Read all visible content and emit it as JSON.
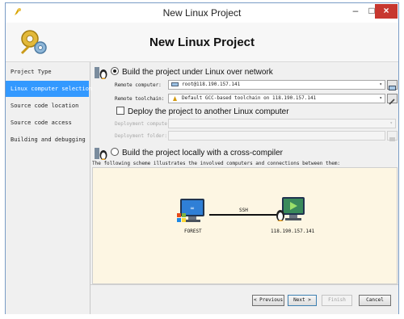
{
  "window": {
    "title": "New Linux Project",
    "minimize": "–",
    "maximize": "□",
    "close": "×"
  },
  "header": {
    "title": "New Linux Project"
  },
  "sidebar": {
    "items": [
      {
        "label": "Project Type"
      },
      {
        "label": "Linux computer selection"
      },
      {
        "label": "Source code location"
      },
      {
        "label": "Source code access"
      },
      {
        "label": "Building and debugging"
      }
    ]
  },
  "network_option": {
    "label": "Build the project under Linux over network",
    "remote_computer_label": "Remote computer:",
    "remote_computer_value": "root@118.190.157.141",
    "remote_toolchain_label": "Remote toolchain:",
    "remote_toolchain_value": "Default GCC-based toolchain on 118.190.157.141",
    "deploy_label": "Deploy the project to another Linux computer",
    "deployment_computer_label": "Deployment computer:",
    "deployment_folder_label": "Deployment folder:"
  },
  "local_option": {
    "label": "Build the project locally with a cross-compiler"
  },
  "scheme": {
    "description": "The following scheme illustrates the involved computers and connections between them:",
    "left_node": "FOREST",
    "right_node": "118.190.157.141",
    "connection": "SSH"
  },
  "footer": {
    "previous": "< Previous",
    "next": "Next >",
    "finish": "Finish",
    "cancel": "Cancel"
  },
  "colors": {
    "selection": "#3399ff",
    "close_button": "#c7372f",
    "scheme_bg": "#fdf6e3"
  }
}
